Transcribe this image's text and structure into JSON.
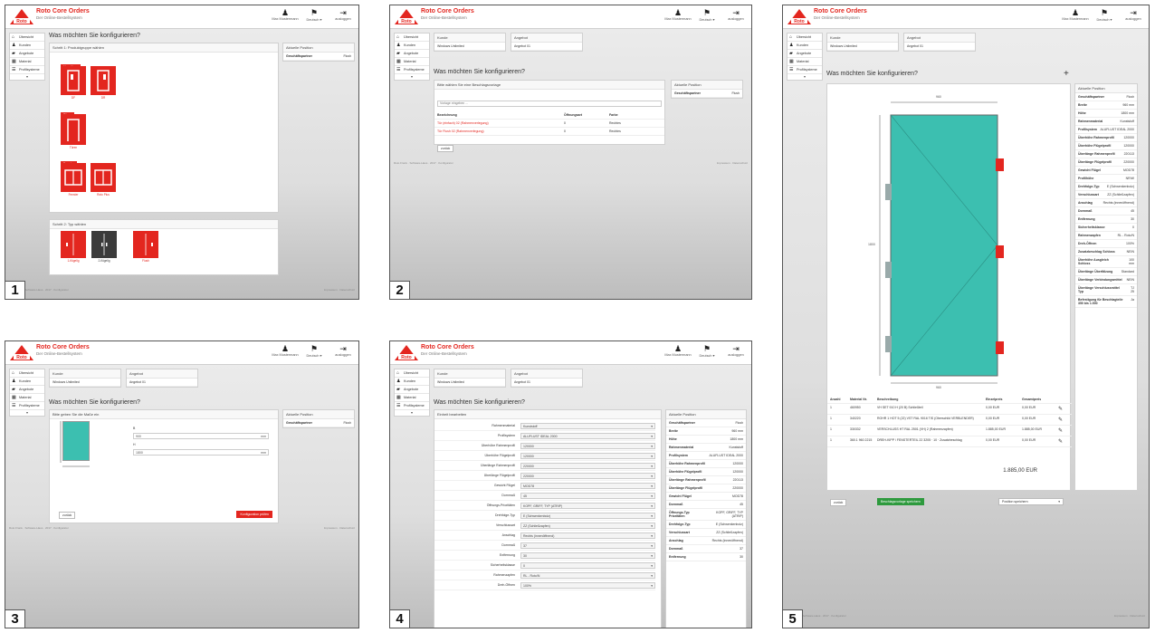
{
  "app": {
    "title": "Roto Core Orders",
    "subtitle": "Der Online-Bestellsystem"
  },
  "topbar": {
    "user": "Max Mustermann",
    "language": "Deutsch ▾",
    "logout": "ausloggen"
  },
  "sidebar": [
    {
      "icon": "home-icon",
      "label": "Übersicht"
    },
    {
      "icon": "users-icon",
      "label": "Kunden"
    },
    {
      "icon": "folder-icon",
      "label": "Angebote"
    },
    {
      "icon": "grid-icon",
      "label": "Material"
    },
    {
      "icon": "list-icon",
      "label": "Profilsysteme"
    }
  ],
  "common": {
    "heading": "Was möchten Sie konfigurieren?",
    "kunde_label": "Kunde",
    "kunde_value": "Windows Unlimited",
    "angebot_label": "Angebot",
    "angebot_value": "Angebot 01",
    "position_title": "Aktuelle Position",
    "geschaeftspartner_label": "Geschäftspartner",
    "geschaeftspartner_value": "Flush",
    "back": "zurück",
    "footer_left": "Roto Frank · Software-Haus · 2017 · Konfigurator",
    "footer_right": "Impressum · Datenschutz"
  },
  "screen1": {
    "number": "1",
    "panel_title": "Schritt 1: Produktgruppe wählen",
    "groups": [
      {
        "tag": "Haustüren",
        "tiles": [
          "DF",
          "DR"
        ]
      },
      {
        "tag": "Türen",
        "tiles": [
          "Türen"
        ]
      },
      {
        "tag": "Fenster",
        "tiles": [
          "Fenster",
          "Roto Plus"
        ]
      }
    ],
    "step2_title": "Schritt 2: Typ wählen",
    "types": [
      "1-flügelig",
      "2-flügelig",
      "Flush"
    ]
  },
  "screen2": {
    "number": "2",
    "panel_title": "Bitte wählen Sie eine Beschlagsvorlage",
    "search_placeholder": "Vorlage eingeben ...",
    "columns": [
      "Bezeichnung",
      "Öffnungsart",
      "Farbe"
    ],
    "rows": [
      {
        "name": "Tür (einfach) 02 (Rahmenverlegung)",
        "open": "0",
        "color": "Rechtes"
      },
      {
        "name": "Tür Flush 02 (Rahmenverlegung)",
        "open": "0",
        "color": "Rechtes"
      }
    ]
  },
  "screen3": {
    "number": "3",
    "panel_title": "Bitte geben Sie die Maße ein",
    "width_label": "B",
    "width_value": "900",
    "height_label": "H",
    "height_value": "1800",
    "unit": "mm",
    "confirm": "Konfiguration prüfen"
  },
  "screen4": {
    "number": "4",
    "panel_title": "Einheit bearbeiten",
    "fields": [
      {
        "label": "Rahmenmaterial",
        "value": "Kunststoff"
      },
      {
        "label": "Profilsystem",
        "value": "ALUFLUST IDEAL 2000"
      },
      {
        "label": "Überhöhe Rahmenprofil",
        "value": "120000"
      },
      {
        "label": "Überhöhe Flügelprofil",
        "value": "120000"
      },
      {
        "label": "Überlänge Rahmenprofil",
        "value": "220000"
      },
      {
        "label": "Überlänge Flügelprofil",
        "value": "220000"
      },
      {
        "label": "Gewicht Flügel",
        "value": "MOD78"
      },
      {
        "label": "Dornmaß",
        "value": "45"
      },
      {
        "label": "Öffnungs-Prioritäten",
        "value": "KOPF, GRIFF, TYP (ATRIP)"
      },
      {
        "label": "Drehfolge-Typ",
        "value": "E (Schwenkenbolz)"
      },
      {
        "label": "Verschlussart",
        "value": "ZZ (Schließzapfen)"
      },
      {
        "label": "Anschlag",
        "value": "Rechts (innenöffnend)"
      },
      {
        "label": "Dornmaß",
        "value": "37"
      },
      {
        "label": "Entfernung",
        "value": "30"
      },
      {
        "label": "Sicherheitsklasse",
        "value": "0"
      },
      {
        "label": "Rahmenzapfen",
        "value": "RL - Roto/N"
      },
      {
        "label": "Dreh-Öffnen",
        "value": "100%"
      }
    ],
    "position": [
      {
        "label": "Geschäftspartner",
        "value": "Flush"
      },
      {
        "label": "Breite",
        "value": "960 mm"
      },
      {
        "label": "Höhe",
        "value": "1800 mm"
      },
      {
        "label": "Rahmenmaterial",
        "value": "Kunststoff"
      },
      {
        "label": "Profilsystem",
        "value": "ALUFLUST IDEAL 2000"
      },
      {
        "label": "Überhöhe Rahmenprofil",
        "value": "120000"
      },
      {
        "label": "Überhöhe Flügelprofil",
        "value": "120000"
      },
      {
        "label": "Überlänge Rahmenprofil",
        "value": "220113"
      },
      {
        "label": "Überlänge Flügelprofil",
        "value": "220000"
      },
      {
        "label": "Gewicht Flügel",
        "value": "MOD78"
      },
      {
        "label": "Dornmaß",
        "value": "45"
      },
      {
        "label": "Öffnungs-Typ Prioritäten",
        "value": "KOPF, GRIFF, TYP (ATRIP)"
      },
      {
        "label": "Drehfolge-Typ",
        "value": "E (Schwenkenbolz)"
      },
      {
        "label": "Verschlussart",
        "value": "ZZ (Schließzapfen)"
      },
      {
        "label": "Anschlag",
        "value": "Rechts (innenöffnend)"
      },
      {
        "label": "Dornmaß",
        "value": "37"
      },
      {
        "label": "Entfernung",
        "value": "30"
      }
    ]
  },
  "screen5": {
    "number": "5",
    "dimension_top": "960",
    "dimension_bottom": "960",
    "dimension_left": "1800",
    "columns": [
      "Anzahl",
      "Material Nr.",
      "Beschreibung",
      "Einzelpreis",
      "Gesamtpreis"
    ],
    "rows": [
      {
        "qty": "1",
        "mat": "460950",
        "desc": "VH SET 910 H (20 B) Schließteil",
        "unit": "0,00 EUR",
        "total": "0,00 EUR"
      },
      {
        "qty": "1",
        "mat": "340220",
        "desc": "ROHR 1 HOT 5 (22) VST RAL 9016 TIS (Oberschild VERBLENDER)",
        "unit": "0,00 EUR",
        "total": "0,00 EUR"
      },
      {
        "qty": "1",
        "mat": "330332",
        "desc": "VERSCHLUSS HT RAL 2501 (VH) 2 (Rahmenzapfen)",
        "unit": "1.885,00 EUR",
        "total": "1.885,00 EUR"
      },
      {
        "qty": "1",
        "mat": "360.1 960 2215",
        "desc": "DREH-KIPP / FENSTERTEIL 22 3205 · 10 · Zusatzbeschlag",
        "unit": "0,00 EUR",
        "total": "0,00 EUR"
      }
    ],
    "total": "1.885,00 EUR",
    "save_button": "Beschlagsvorlage speichern",
    "position_select": "Position speichern",
    "position": [
      {
        "label": "Geschäftspartner",
        "value": "Flush"
      },
      {
        "label": "Breite",
        "value": "960 mm"
      },
      {
        "label": "Höhe",
        "value": "1800 mm"
      },
      {
        "label": "Rahmenmaterial",
        "value": "Kunststoff"
      },
      {
        "label": "Profilsystem",
        "value": "ALUFLUST IDEAL 2000"
      },
      {
        "label": "Überhöhe Rahmenprofil",
        "value": "120000"
      },
      {
        "label": "Überhöhe Flügelprofil",
        "value": "120000"
      },
      {
        "label": "Überlänge Rahmenprofil",
        "value": "220113"
      },
      {
        "label": "Überlänge Flügelprofil",
        "value": "220000"
      },
      {
        "label": "Gewicht Flügel",
        "value": "MOD78"
      },
      {
        "label": "Profilhöhe",
        "value": "NR/W"
      },
      {
        "label": "Drehfolge-Typ",
        "value": "E (Schwenkenbolz)"
      },
      {
        "label": "Verschlussart",
        "value": "ZZ (Schließzapfen)"
      },
      {
        "label": "Anschlag",
        "value": "Rechts (innenöffnend)"
      },
      {
        "label": "Dornmaß",
        "value": "45"
      },
      {
        "label": "Entfernung",
        "value": "30"
      },
      {
        "label": "Sicherheitsklasse",
        "value": "0"
      },
      {
        "label": "Rahmenzapfen",
        "value": "RL - Roto/N"
      },
      {
        "label": "Dreh-Öffnen",
        "value": "100%"
      },
      {
        "label": "Zusatzbeschlag Schloss",
        "value": "NEIN"
      },
      {
        "label": "Überhöhe Ausgleich Schloss",
        "value": "100 mm"
      },
      {
        "label": "Überlänge Überfälzung",
        "value": "Standard"
      },
      {
        "label": "Überlänge Verbindungsmittel",
        "value": "NEIN"
      },
      {
        "label": "Überlänge Verschlussmittel Typ",
        "value": "TJ 25"
      },
      {
        "label": "Befestigung für Beschlagteile 350 bis 1.500",
        "value": "Ja"
      }
    ]
  },
  "colors": {
    "brand_red": "#e3261f",
    "glass": "#3cbfb0",
    "save_green": "#2e9a3e"
  }
}
